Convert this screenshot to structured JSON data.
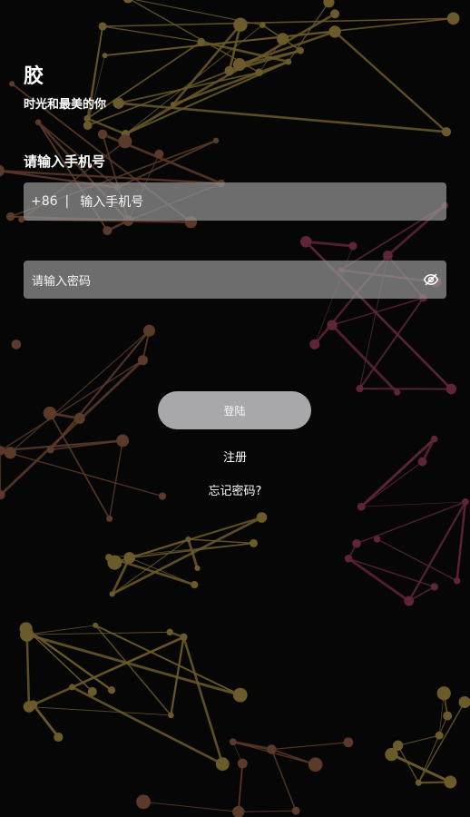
{
  "app": {
    "title": "胶",
    "subtitle": "时光和最美的你"
  },
  "form": {
    "heading": "请输入手机号",
    "phone_prefix": "+86",
    "phone_separator": "|",
    "phone_placeholder": "输入手机号",
    "password_placeholder": "请输入密码",
    "password_toggle_icon": "eye-off-icon"
  },
  "actions": {
    "login_label": "登陆",
    "register_label": "注册",
    "forgot_label": "忘记密码?"
  },
  "colors": {
    "background": "#060606",
    "network_gold": "#6b5a2a",
    "network_brown": "#5b3a2a",
    "network_magenta": "#5e2535",
    "button": "#a8a8aa"
  }
}
